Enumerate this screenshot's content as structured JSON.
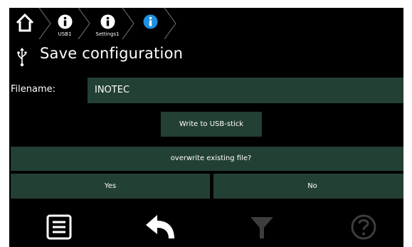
{
  "breadcrumb": {
    "items": [
      {
        "label": ""
      },
      {
        "label": "USB1"
      },
      {
        "label": "Settings1"
      },
      {
        "label": ""
      }
    ]
  },
  "title": "Save configuration",
  "filename": {
    "label": "Filename:",
    "value": "INOTEC"
  },
  "buttons": {
    "write": "Write to USB-stick",
    "overwrite": "overwrite existing file?",
    "yes": "Yes",
    "no": "No"
  },
  "colors": {
    "background": "#000000",
    "button": "#234034",
    "accent_info": "#1e90e0",
    "disabled": "#3a3a3a"
  },
  "bottom_bar": [
    "list-icon",
    "back-icon",
    "filter-icon",
    "help-icon"
  ]
}
